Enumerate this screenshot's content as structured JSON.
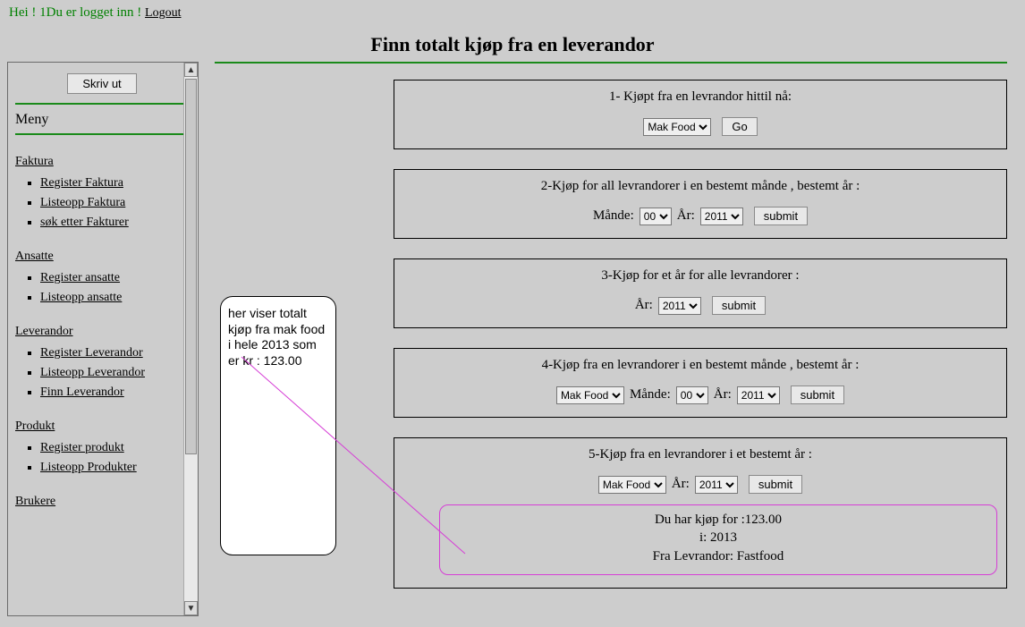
{
  "header": {
    "greeting": "Hei ! 1Du er logget inn !",
    "logout": "Logout"
  },
  "page_title": "Finn totalt kjøp fra en leverandor",
  "sidebar": {
    "print_label": "Skriv ut",
    "menu_heading": "Meny",
    "sections": [
      {
        "title": "Faktura",
        "items": [
          "Register Faktura",
          "Listeopp Faktura",
          "søk etter Fakturer"
        ]
      },
      {
        "title": "Ansatte",
        "items": [
          "Register ansatte",
          "Listeopp ansatte"
        ]
      },
      {
        "title": "Leverandor",
        "items": [
          "Register Leverandor",
          "Listeopp Leverandor",
          "Finn Leverandor"
        ]
      },
      {
        "title": "Produkt",
        "items": [
          "Register produkt",
          "Listeopp Produkter"
        ]
      },
      {
        "title": "Brukere",
        "items": []
      }
    ]
  },
  "note": "her viser totalt kjøp fra mak food i hele 2013 som er kr : 123.00",
  "blocks": {
    "b1": {
      "title": "1- Kjøpt fra en levrandor hittil nå:",
      "supplier": "Mak Food",
      "go": "Go"
    },
    "b2": {
      "title": "2-Kjøp for all levrandorer i en bestemt månde , bestemt år :",
      "month_label": "Månde:",
      "month": "00",
      "year_label": "År:",
      "year": "2011",
      "submit": "submit"
    },
    "b3": {
      "title": "3-Kjøp for et år for alle levrandorer :",
      "year_label": "År:",
      "year": "2011",
      "submit": "submit"
    },
    "b4": {
      "title": "4-Kjøp fra en levrandorer i en bestemt månde , bestemt år :",
      "supplier": "Mak Food",
      "month_label": "Månde:",
      "month": "00",
      "year_label": "År:",
      "year": "2011",
      "submit": "submit"
    },
    "b5": {
      "title": "5-Kjøp fra en levrandorer i et bestemt år :",
      "supplier": "Mak Food",
      "year_label": "År:",
      "year": "2011",
      "submit": "submit"
    }
  },
  "result": {
    "line1": "Du har kjøp for :123.00",
    "line2": "i: 2013",
    "line3": "Fra Levrandor: Fastfood"
  }
}
